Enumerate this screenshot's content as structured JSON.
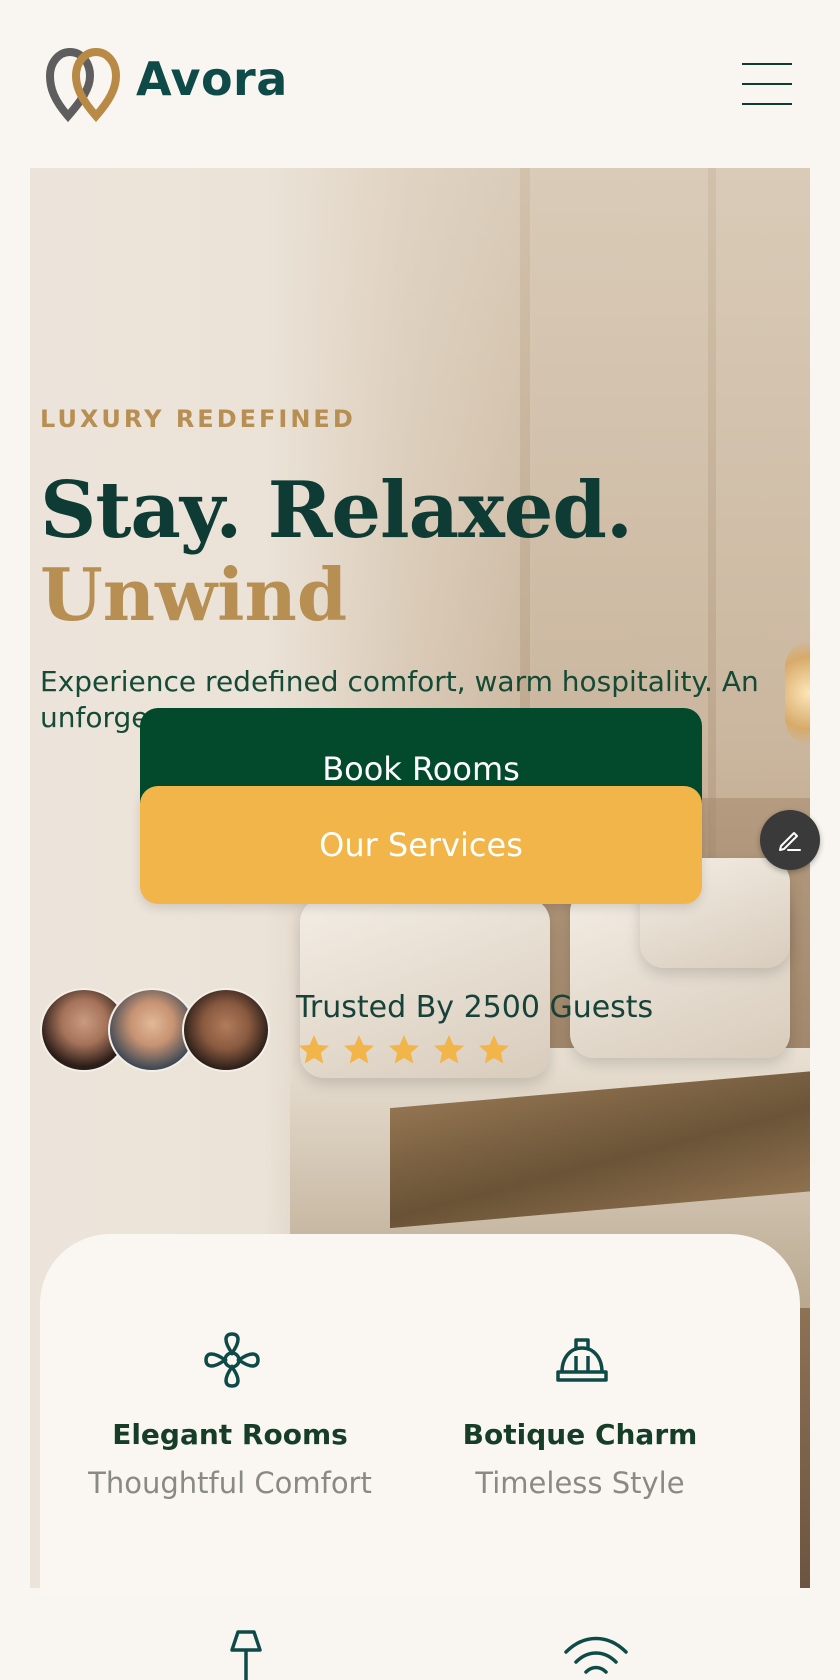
{
  "header": {
    "brand": "Avora",
    "logo_icon": "avora-logo",
    "menu_icon": "hamburger-icon"
  },
  "hero": {
    "eyebrow": "LUXURY REDEFINED",
    "headline_line1": "Stay. Relaxed.",
    "headline_line2": "Unwind",
    "description": "Experience redefined comfort, warm hospitality. An unforge",
    "book_button": "Book Rooms",
    "services_button": "Our Services",
    "edit_icon": "pencil-icon",
    "trusted_text": "Trusted By 2500 Guests",
    "rating": 5,
    "rating_max": 5,
    "colors": {
      "primary": "#0e3b34",
      "accent": "#b88f52",
      "book_button": "#034a2d",
      "services_button": "#f2b54a",
      "star": "#f2b54a"
    }
  },
  "features": [
    {
      "title": "Elegant Rooms",
      "subtitle": "Thoughtful Comfort",
      "icon": "flower-icon"
    },
    {
      "title": "Botique Charm",
      "subtitle": "Timeless Style",
      "icon": "hard-hat-icon"
    }
  ],
  "bottom_icons": [
    "lamp-icon",
    "wifi-icon"
  ]
}
